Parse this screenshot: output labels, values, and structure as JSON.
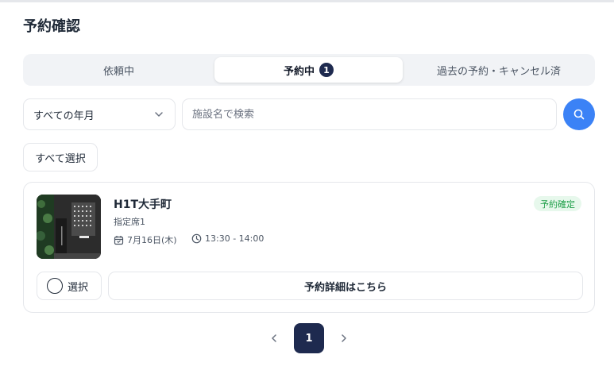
{
  "page": {
    "title": "予約確認"
  },
  "tabs": [
    {
      "label": "依頼中"
    },
    {
      "label": "予約中",
      "badge": "1"
    },
    {
      "label": "過去の予約・キャンセル済"
    }
  ],
  "filters": {
    "period_select": {
      "value": "すべての年月",
      "icon": "chevron-down-icon"
    },
    "search": {
      "placeholder": "施設名で検索",
      "value": "",
      "icon": "search-icon"
    }
  },
  "select_all_label": "すべて選択",
  "reservations": [
    {
      "facility": "H1T大手町",
      "seat": "指定席1",
      "date": "7月16日(木)",
      "time": "13:30 - 14:00",
      "status": "予約確定",
      "select_label": "選択",
      "detail_label": "予約詳細はこちら",
      "date_icon": "calendar-icon",
      "time_icon": "clock-icon"
    }
  ],
  "pagination": {
    "current": "1",
    "prev_icon": "chevron-left-icon",
    "next_icon": "chevron-right-icon"
  },
  "colors": {
    "accent": "#3b82f6",
    "navy": "#1e2a4f",
    "status_green": "#22a04b",
    "status_bg": "#e7f8ec"
  }
}
